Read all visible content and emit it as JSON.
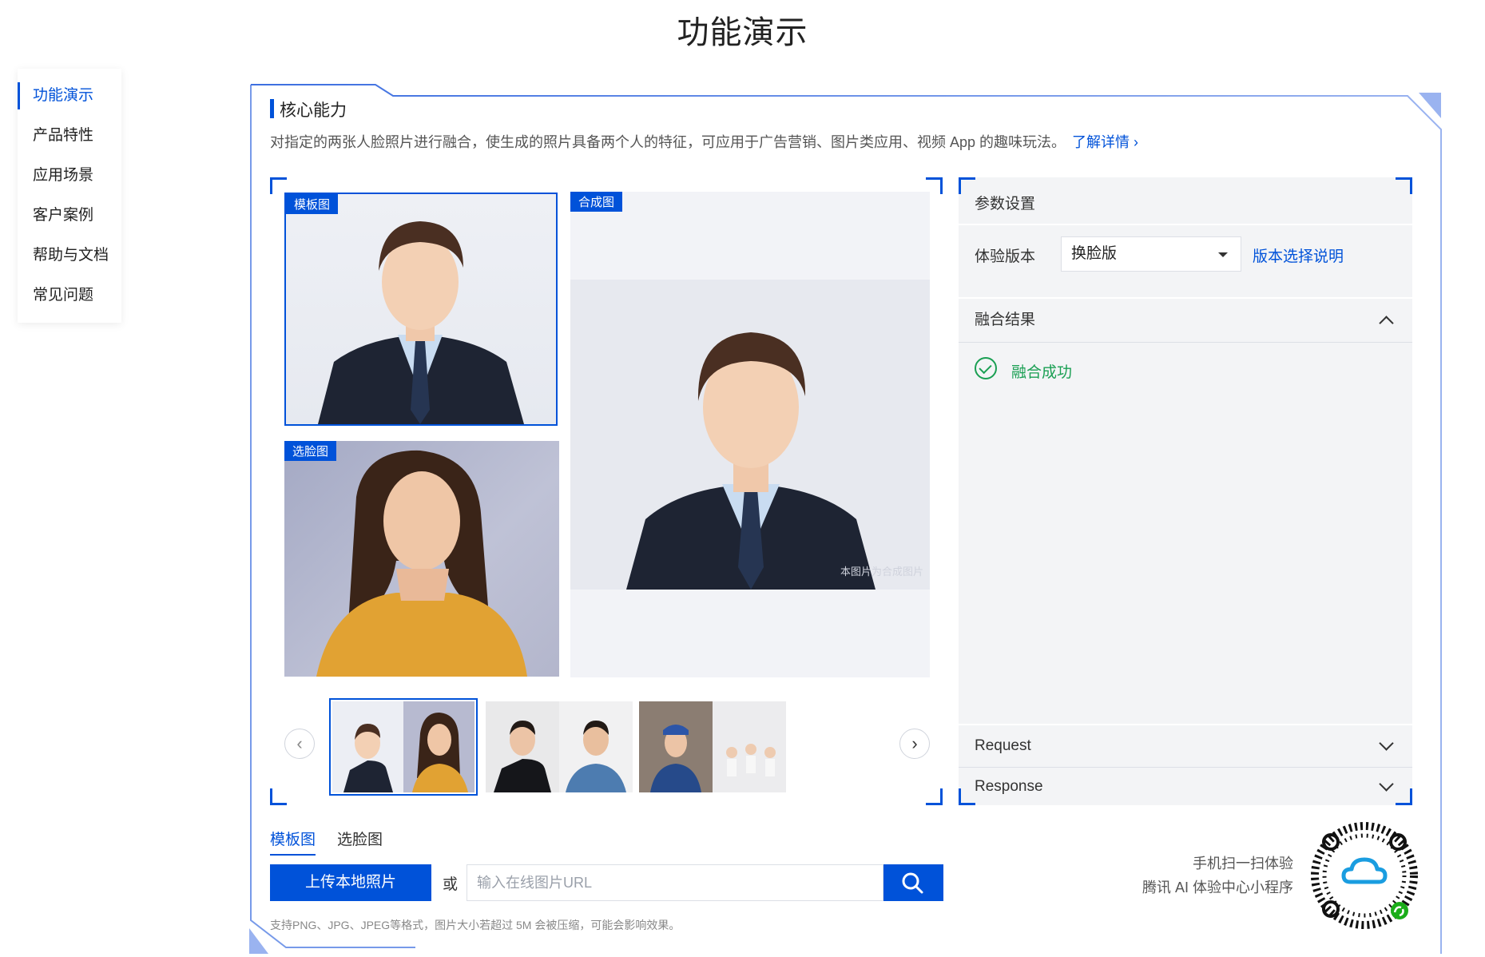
{
  "page": {
    "title": "功能演示"
  },
  "sidebar": {
    "items": [
      {
        "label": "功能演示",
        "active": true
      },
      {
        "label": "产品特性"
      },
      {
        "label": "应用场景"
      },
      {
        "label": "客户案例"
      },
      {
        "label": "帮助与文档"
      },
      {
        "label": "常见问题"
      }
    ]
  },
  "core": {
    "title": "核心能力",
    "description": "对指定的两张人脸照片进行融合，使生成的照片具备两个人的特征，可应用于广告营销、图片类应用、视频 App 的趣味玩法。",
    "learn_more": "了解详情"
  },
  "images": {
    "template_tag": "模板图",
    "face_tag": "选脸图",
    "result_tag": "合成图",
    "watermark": "本图片为合成图片"
  },
  "panel": {
    "params_title": "参数设置",
    "version_label": "体验版本",
    "version_value": "换脸版",
    "version_link": "版本选择说明",
    "result_title": "融合结果",
    "result_status": "融合成功",
    "request_label": "Request",
    "response_label": "Response"
  },
  "upload": {
    "tab_template": "模板图",
    "tab_face": "选脸图",
    "upload_button": "上传本地照片",
    "or": "或",
    "url_placeholder": "输入在线图片URL",
    "hint": "支持PNG、JPG、JPEG等格式，图片大小若超过 5M 会被压缩，可能会影响效果。"
  },
  "miniprogram": {
    "line1": "手机扫一扫体验",
    "line2": "腾讯 AI 体验中心小程序"
  },
  "colors": {
    "brand": "#0052d9",
    "success": "#1a9f53"
  }
}
